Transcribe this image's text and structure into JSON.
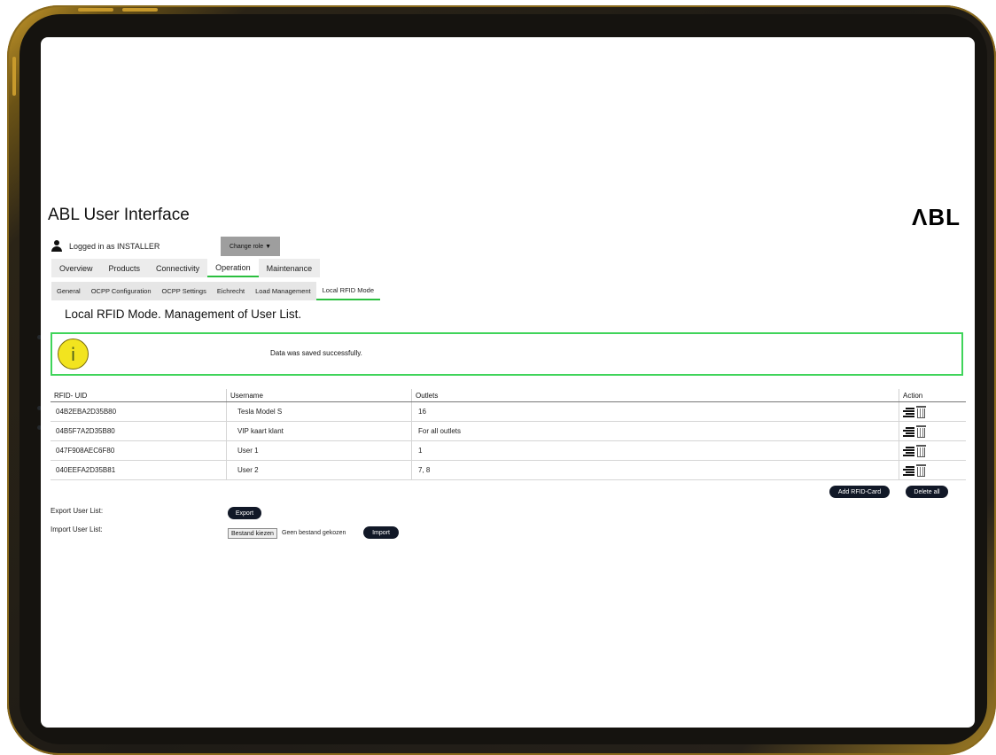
{
  "header": {
    "app_title": "ABL User Interface",
    "brand": "ΛBL"
  },
  "session": {
    "logged_in_text": "Logged in as INSTALLER",
    "change_role_label": "Change role ▼"
  },
  "tabs": [
    {
      "label": "Overview",
      "active": false
    },
    {
      "label": "Products",
      "active": false
    },
    {
      "label": "Connectivity",
      "active": false
    },
    {
      "label": "Operation",
      "active": true
    },
    {
      "label": "Maintenance",
      "active": false
    }
  ],
  "subtabs": [
    {
      "label": "General",
      "active": false
    },
    {
      "label": "OCPP Configuration",
      "active": false
    },
    {
      "label": "OCPP Settings",
      "active": false
    },
    {
      "label": "Eichrecht",
      "active": false
    },
    {
      "label": "Load Management",
      "active": false
    },
    {
      "label": "Local RFID Mode",
      "active": true
    }
  ],
  "page": {
    "section_title": "Local RFID Mode. Management of User List."
  },
  "alert": {
    "icon_glyph": "i",
    "message": "Data was saved successfully."
  },
  "table": {
    "columns": [
      "RFID- UID",
      "Username",
      "Outlets",
      "Action"
    ],
    "rows": [
      {
        "uid": "04B2EBA2D35B80",
        "username": "Tesla Model S",
        "outlets": "16"
      },
      {
        "uid": "04B5F7A2D35B80",
        "username": "VIP kaart klant",
        "outlets": "For all outlets"
      },
      {
        "uid": "047F908AEC6F80",
        "username": "User 1",
        "outlets": "1"
      },
      {
        "uid": "040EEFA2D35B81",
        "username": "User 2",
        "outlets": "7, 8"
      }
    ]
  },
  "buttons": {
    "add_rfid": "Add RFID-Card",
    "delete_all": "Delete all",
    "export": "Export",
    "import": "Import"
  },
  "io": {
    "export_label": "Export User List:",
    "import_label": "Import User List:",
    "file_choose": "Bestand kiezen",
    "file_none": "Geen bestand gekozen"
  },
  "colors": {
    "accent_green": "#2bbf3f",
    "alert_border": "#3fd45a",
    "info_icon_fill": "#f2e41f",
    "button_dark": "#111827",
    "frame_gold": "#c99a2a"
  }
}
